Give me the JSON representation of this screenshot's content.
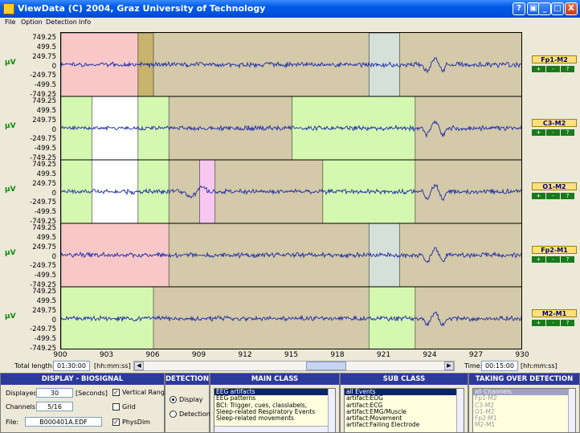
{
  "window": {
    "title": "ViewData (C) 2004, Graz University of Technology",
    "buttons": [
      "?",
      "▣",
      "_",
      "□",
      "X"
    ]
  },
  "menu": [
    "File",
    "Option",
    "Detection",
    "Info"
  ],
  "axes": {
    "y_unit": "μV",
    "y_ticks": [
      "749.25",
      "499.5",
      "249.75",
      "0",
      "-249.75",
      "-499.5",
      "-749.25"
    ],
    "x_ticks": [
      "900",
      "903",
      "906",
      "909",
      "912",
      "915",
      "918",
      "921",
      "924",
      "927",
      "930"
    ]
  },
  "chart_data": {
    "type": "line",
    "x_range": [
      900,
      930
    ],
    "y_range": [
      -749.25,
      749.25
    ],
    "series": [
      {
        "name": "Fp1-M2"
      },
      {
        "name": "C3-M2"
      },
      {
        "name": "O1-M2"
      },
      {
        "name": "Fp2-M1"
      },
      {
        "name": "M2-M1"
      }
    ],
    "event_colors": {
      "background": "#d4c9a8",
      "pink": "#f8c8c8",
      "green": "#d4f8b0",
      "white": "#ffffff",
      "olive": "#c8b46a",
      "gray": "#d4e0d8",
      "magenta": "#f8c8f0",
      "trace": "#1a2aa8"
    },
    "events": [
      {
        "channel": 0,
        "start": 900.0,
        "end": 905.0,
        "color": "pink"
      },
      {
        "channel": 0,
        "start": 905.0,
        "end": 906.0,
        "color": "olive"
      },
      {
        "channel": 0,
        "start": 920.0,
        "end": 922.0,
        "color": "gray"
      },
      {
        "channel": 1,
        "start": 900.0,
        "end": 902.0,
        "color": "green"
      },
      {
        "channel": 1,
        "start": 902.0,
        "end": 905.0,
        "color": "white"
      },
      {
        "channel": 1,
        "start": 905.0,
        "end": 907.0,
        "color": "green"
      },
      {
        "channel": 1,
        "start": 915.0,
        "end": 923.0,
        "color": "green"
      },
      {
        "channel": 2,
        "start": 900.0,
        "end": 902.0,
        "color": "green"
      },
      {
        "channel": 2,
        "start": 902.0,
        "end": 905.0,
        "color": "white"
      },
      {
        "channel": 2,
        "start": 905.0,
        "end": 907.0,
        "color": "green"
      },
      {
        "channel": 2,
        "start": 909.0,
        "end": 910.0,
        "color": "magenta"
      },
      {
        "channel": 2,
        "start": 917.0,
        "end": 923.0,
        "color": "green"
      },
      {
        "channel": 3,
        "start": 900.0,
        "end": 907.0,
        "color": "pink"
      },
      {
        "channel": 3,
        "start": 920.0,
        "end": 922.0,
        "color": "gray"
      },
      {
        "channel": 4,
        "start": 900.0,
        "end": 906.0,
        "color": "green"
      },
      {
        "channel": 4,
        "start": 920.0,
        "end": 923.0,
        "color": "green"
      }
    ]
  },
  "channel_controls": {
    "btn_plus": "+",
    "btn_minus": "-",
    "btn_help": "?"
  },
  "bottom_row": {
    "total_length_label": "Total length:",
    "total_length_value": "01:30:00",
    "total_length_unit": "[hh:mm:ss]",
    "time_label": "Time:",
    "time_value": "00:15:00",
    "time_unit": "[hh:mm:ss]"
  },
  "display_panel": {
    "title": "DISPLAY - BIOSIGNAL",
    "displayed_label": "Displayed:",
    "displayed_value": "30",
    "displayed_unit": "[Seconds]",
    "channels_label": "Channels:",
    "channels_value": "5/16",
    "file_label": "File:",
    "file_value": "B000401A.EDF",
    "vertical_range_label": "Vertical Range",
    "grid_label": "Grid",
    "physdim_label": "PhysDim",
    "vertical_range_checked": true,
    "grid_checked": false,
    "physdim_checked": true
  },
  "detection_panel": {
    "title": "DETECTION",
    "display_label": "Display",
    "detection_label": "Detection"
  },
  "main_class": {
    "title": "MAIN CLASS",
    "items": [
      "EEG artifacts",
      "EEG patterns",
      "BCI: Trigger, cues, classlabels,",
      "Sleep-related Respiratory Events",
      "Sleep-related movements"
    ],
    "selected": 0
  },
  "sub_class": {
    "title": "SUB CLASS",
    "items": [
      "all Events",
      "artifact:EOG",
      "artifact:ECG",
      "artifact:EMG/Muscle",
      "artifact:Movement",
      "artifact:Failing Electrode"
    ],
    "selected": 0
  },
  "taking_over": {
    "title": "TAKING OVER DETECTION",
    "items": [
      "all Channels",
      "Fp1-M2",
      "C3-M2",
      "O1-M2",
      "Fp2-M1",
      "M2-M1"
    ],
    "selected": 0
  }
}
